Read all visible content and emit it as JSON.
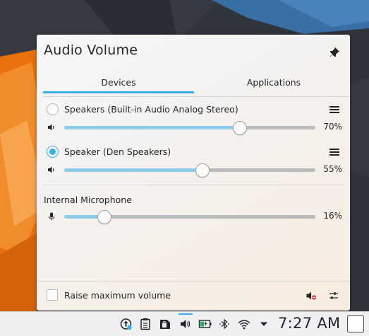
{
  "popup": {
    "title": "Audio Volume",
    "tabs": [
      {
        "label": "Devices",
        "active": true
      },
      {
        "label": "Applications",
        "active": false
      }
    ]
  },
  "devices": [
    {
      "name": "Speakers (Built-in Audio Analog Stereo)",
      "selected": false,
      "volume_percent": 70,
      "volume_label": "70%"
    },
    {
      "name": "Speaker (Den Speakers)",
      "selected": true,
      "volume_percent": 55,
      "volume_label": "55%"
    }
  ],
  "input": {
    "section_label": "Internal Microphone",
    "volume_percent": 16,
    "volume_label": "16%"
  },
  "footer": {
    "raise_max_label": "Raise maximum volume",
    "raise_max_checked": false
  },
  "taskbar": {
    "clock": "7:27 AM",
    "tray_icons": [
      "updates-icon",
      "clipboard-icon",
      "vault-icon",
      "volume-icon",
      "battery-icon",
      "bluetooth-icon",
      "wifi-icon",
      "expand-tray-icon"
    ]
  },
  "colors": {
    "accent": "#3daee9",
    "slider_fill": "#8fcbea",
    "slider_track": "#b9bbbd",
    "wallpaper_orange": "#e9710d",
    "wallpaper_blue": "#3a6fa5",
    "muted_red": "#da4453"
  }
}
